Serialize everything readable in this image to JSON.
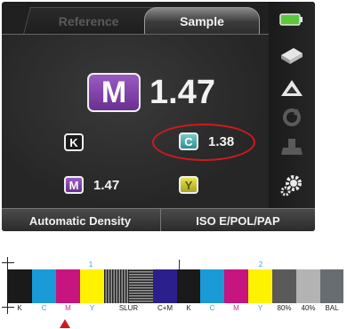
{
  "tabs": [
    {
      "label": "Reference",
      "active": false
    },
    {
      "label": "Sample",
      "active": true
    }
  ],
  "main": {
    "primary_channel": "M",
    "primary_value": "1.47",
    "channels": [
      {
        "badge": "K",
        "value": ""
      },
      {
        "badge": "C",
        "value": "1.38",
        "highlighted": true
      },
      {
        "badge": "M",
        "value": "1.47"
      },
      {
        "badge": "Y",
        "value": ""
      }
    ]
  },
  "footer": {
    "left": "Automatic Density",
    "right": "ISO E/POL/PAP"
  },
  "side_icons": [
    "battery-icon",
    "paper-tray-icon",
    "delta-icon",
    "sync-icon",
    "stamp-icon",
    "gear-icon"
  ],
  "colors": {
    "accent_red": "#d0191d",
    "magenta_badge": "#7b3ba6",
    "cyan_badge": "#3f9fa1",
    "yellow_badge": "#d7d23a",
    "battery_green": "#5cc73d"
  },
  "colorbar": {
    "index_labels": [
      "1",
      "2"
    ],
    "patch_labels": [
      "K",
      "C",
      "M",
      "Y",
      "SLUR",
      "C+M",
      "K",
      "C",
      "M",
      "Y",
      "80%",
      "40%",
      "BAL"
    ],
    "patches": [
      {
        "color": "#1a1a1a"
      },
      {
        "color": "#1a9ad7"
      },
      {
        "color": "#c6157f"
      },
      {
        "color": "#fff200"
      },
      {
        "color": "slur"
      },
      {
        "color": "#2b1f8c"
      },
      {
        "color": "#1a1a1a"
      },
      {
        "color": "#1a9ad7"
      },
      {
        "color": "#c6157f"
      },
      {
        "color": "#fff200"
      },
      {
        "color": "#5a5a5a"
      },
      {
        "color": "#b3b3b3"
      },
      {
        "color": "#686d72"
      }
    ],
    "selected_patch": "M"
  }
}
